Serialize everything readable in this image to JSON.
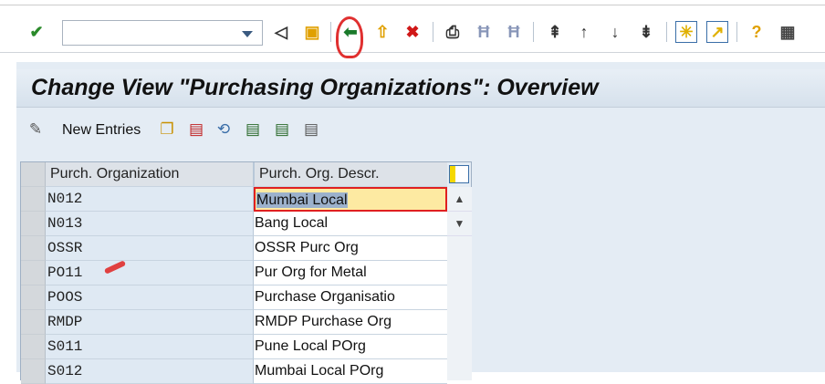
{
  "toolbar": {
    "command_field": "",
    "icons": [
      "enter-icon",
      "back-nav-icon",
      "save-icon",
      "back-icon",
      "exit-icon",
      "cancel-icon",
      "print-icon",
      "find-icon",
      "find-next-icon",
      "first-page-icon",
      "previous-page-icon",
      "next-page-icon",
      "last-page-icon",
      "create-session-icon",
      "shortcut-icon",
      "help-icon",
      "customize-layout-icon"
    ]
  },
  "header": {
    "title": "Change View \"Purchasing Organizations\": Overview"
  },
  "app_toolbar": {
    "new_entries": "New Entries"
  },
  "table": {
    "columns": [
      "Purch. Organization",
      "Purch. Org. Descr."
    ],
    "rows": [
      {
        "org": "N012",
        "descr": "Mumbai Local"
      },
      {
        "org": "N013",
        "descr": "Bang Local"
      },
      {
        "org": "OSSR",
        "descr": "OSSR Purc Org"
      },
      {
        "org": "PO11",
        "descr": "Pur Org for Metal"
      },
      {
        "org": "POOS",
        "descr": "Purchase Organisatio"
      },
      {
        "org": "RMDP",
        "descr": "RMDP Purchase Org"
      },
      {
        "org": "S011",
        "descr": "Pune Local POrg"
      },
      {
        "org": "S012",
        "descr": "Mumbai Local POrg"
      }
    ]
  }
}
